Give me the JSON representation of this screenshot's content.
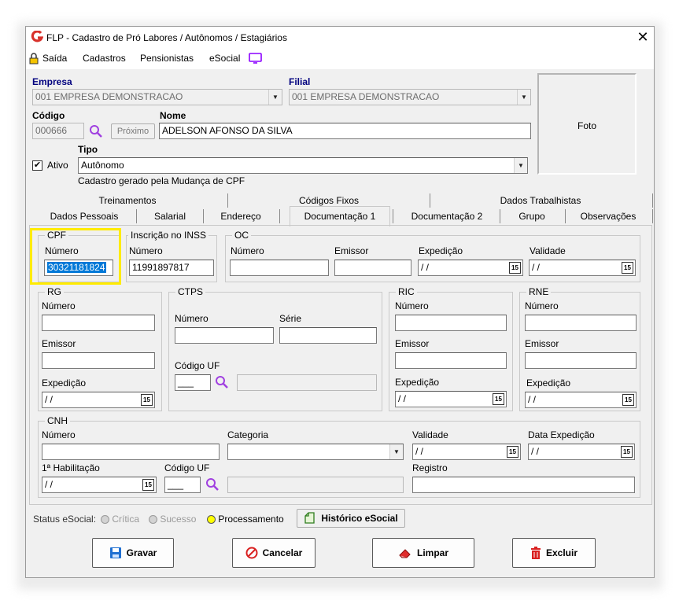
{
  "window": {
    "title": "FLP - Cadastro de Pró Labores / Autônomos / Estagiários",
    "close": "✕"
  },
  "menu": {
    "items": [
      "Saída",
      "Cadastros",
      "Pensionistas",
      "eSocial"
    ]
  },
  "header": {
    "empresa_label": "Empresa",
    "empresa_value": "001 EMPRESA DEMONSTRACAO",
    "filial_label": "Filial",
    "filial_value": "001 EMPRESA DEMONSTRACAO",
    "codigo_label": "Código",
    "codigo_value": "000666",
    "proximo_label": "Próximo",
    "nome_label": "Nome",
    "nome_value": "ADELSON AFONSO DA SILVA",
    "tipo_label": "Tipo",
    "tipo_value": "Autônomo",
    "ativo_label": "Ativo",
    "ativo_checked": "✔",
    "cpf_change_note": "Cadastro gerado pela Mudança de CPF",
    "foto_label": "Foto"
  },
  "tabs_row1": [
    "Treinamentos",
    "Códigos Fixos",
    "Dados Trabalhistas"
  ],
  "tabs_row2": [
    "Dados Pessoais",
    "Salarial",
    "Endereço",
    "Documentação 1",
    "Documentação 2",
    "Grupo",
    "Observações"
  ],
  "doc": {
    "cpf": {
      "title": "CPF",
      "numero_label": "Número",
      "numero_value": "30321181824"
    },
    "inss": {
      "title": "Inscrição no INSS",
      "numero_label": "Número",
      "numero_value": "11991897817"
    },
    "oc": {
      "title": "OC",
      "numero_label": "Número",
      "emissor_label": "Emissor",
      "expedicao_label": "Expedição",
      "expedicao_value": " / /",
      "validade_label": "Validade",
      "validade_value": " / /"
    },
    "rg": {
      "title": "RG",
      "numero_label": "Número",
      "emissor_label": "Emissor",
      "expedicao_label": "Expedição",
      "expedicao_value": " / /"
    },
    "ctps": {
      "title": "CTPS",
      "numero_label": "Número",
      "serie_label": "Série",
      "codigo_uf_label": "Código UF",
      "codigo_uf_value": "___"
    },
    "ric": {
      "title": "RIC",
      "numero_label": "Número",
      "emissor_label": "Emissor",
      "expedicao_label": "Expedição",
      "expedicao_value": " / /"
    },
    "rne": {
      "title": "RNE",
      "numero_label": "Número",
      "emissor_label": "Emissor",
      "expedicao_label": "Expedição",
      "expedicao_value": " / /"
    },
    "cnh": {
      "title": "CNH",
      "numero_label": "Número",
      "categoria_label": "Categoria",
      "validade_label": "Validade",
      "validade_value": " / /",
      "data_expedicao_label": "Data Expedição",
      "data_expedicao_value": " / /",
      "habilitacao_label": "1ª Habilitação",
      "habilitacao_value": " / /",
      "codigo_uf_label": "Código UF",
      "codigo_uf_value": "___",
      "registro_label": "Registro"
    }
  },
  "status": {
    "label": "Status eSocial:",
    "critica": "Crítica",
    "sucesso": "Sucesso",
    "processamento": "Processamento",
    "historico": "Histórico eSocial"
  },
  "buttons": {
    "gravar": "Gravar",
    "cancelar": "Cancelar",
    "limpar": "Limpar",
    "excluir": "Excluir"
  },
  "date_icon": "15",
  "colors": {
    "label_blue": "#00007f",
    "highlight": "#ffeb00",
    "selection": "#0078d7",
    "logo_red": "#d8312b",
    "esocial_purple": "#8b00ff"
  }
}
